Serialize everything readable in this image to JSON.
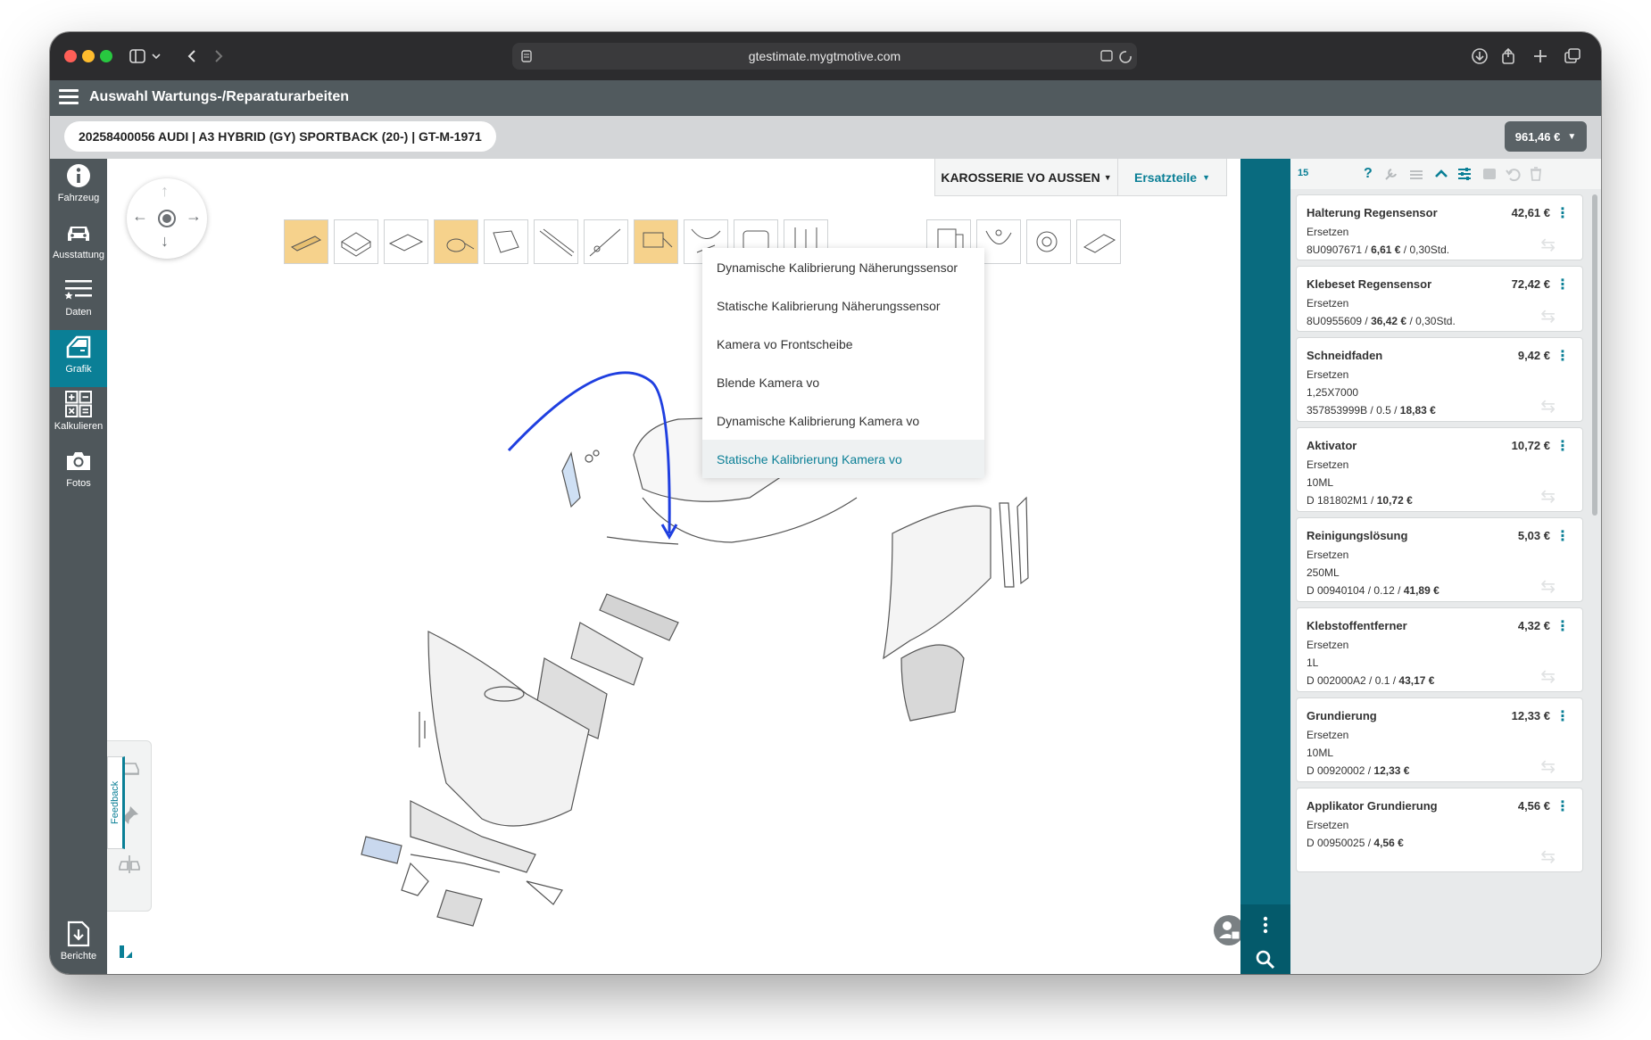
{
  "browser": {
    "url": "gtestimate.mygtmotive.com"
  },
  "app": {
    "title": "Auswahl Wartungs-/Reparaturarbeiten",
    "vehicle": "20258400056  AUDI | A3 HYBRID (GY) SPORTBACK (20-) | GT-M-1971",
    "total_price": "961,46 €"
  },
  "sidebar": {
    "items": [
      {
        "label": "Fahrzeug",
        "icon": "info-icon"
      },
      {
        "label": "Ausstattung",
        "icon": "car-icon"
      },
      {
        "label": "Daten",
        "icon": "list-icon"
      },
      {
        "label": "Grafik",
        "icon": "door-icon"
      },
      {
        "label": "Kalkulieren",
        "icon": "calculator-icon"
      },
      {
        "label": "Fotos",
        "icon": "camera-icon"
      },
      {
        "label": "Berichte",
        "icon": "download-icon"
      }
    ],
    "active": "Grafik"
  },
  "toolbar": {
    "group": "KAROSSERIE VO AUSSEN",
    "mode": "Ersatzteile"
  },
  "dropdown": {
    "items": [
      "Dynamische Kalibrierung Näherungssensor",
      "Statische Kalibrierung Näherungssensor",
      "Kamera vo Frontscheibe",
      "Blende Kamera vo",
      "Dynamische Kalibrierung Kamera vo",
      "Statische Kalibrierung Kamera vo"
    ],
    "selected_index": 5
  },
  "feedback_label": "Feedback",
  "parts_panel": {
    "count": "15",
    "cards": [
      {
        "name": "Halterung Regensensor",
        "price": "42,61 €",
        "action": "Ersetzen",
        "lines": [],
        "ref": "8U0907671 / ",
        "ref_bold": "6,61 €",
        "ref_tail": " / 0,30Std."
      },
      {
        "name": "Klebeset Regensensor",
        "price": "72,42 €",
        "action": "Ersetzen",
        "lines": [],
        "ref": "8U0955609 / ",
        "ref_bold": "36,42 €",
        "ref_tail": " / 0,30Std."
      },
      {
        "name": "Schneidfaden",
        "price": "9,42 €",
        "action": "Ersetzen",
        "lines": [
          "1,25X7000"
        ],
        "ref": "357853999B / 0.5 / ",
        "ref_bold": "18,83 €",
        "ref_tail": ""
      },
      {
        "name": "Aktivator",
        "price": "10,72 €",
        "action": "Ersetzen",
        "lines": [
          "10ML"
        ],
        "ref": "D 181802M1 / ",
        "ref_bold": "10,72 €",
        "ref_tail": ""
      },
      {
        "name": "Reinigungslösung",
        "price": "5,03 €",
        "action": "Ersetzen",
        "lines": [
          "250ML"
        ],
        "ref": "D 00940104 / 0.12 / ",
        "ref_bold": "41,89 €",
        "ref_tail": ""
      },
      {
        "name": "Klebstoffentferner",
        "price": "4,32 €",
        "action": "Ersetzen",
        "lines": [
          "1L"
        ],
        "ref": "D 002000A2 / 0.1 / ",
        "ref_bold": "43,17 €",
        "ref_tail": ""
      },
      {
        "name": "Grundierung",
        "price": "12,33 €",
        "action": "Ersetzen",
        "lines": [
          "10ML"
        ],
        "ref": "D 00920002 / ",
        "ref_bold": "12,33 €",
        "ref_tail": ""
      },
      {
        "name": "Applikator Grundierung",
        "price": "4,56 €",
        "action": "Ersetzen",
        "lines": [],
        "ref": "D 00950025 / ",
        "ref_bold": "4,56 €",
        "ref_tail": ""
      }
    ]
  },
  "colors": {
    "accent": "#0a7f96",
    "teal_strip": "#096b7f",
    "header": "#515a5e",
    "highlight_thumb": "#f6d28c",
    "annotation_arrow": "#1f3fe0"
  }
}
